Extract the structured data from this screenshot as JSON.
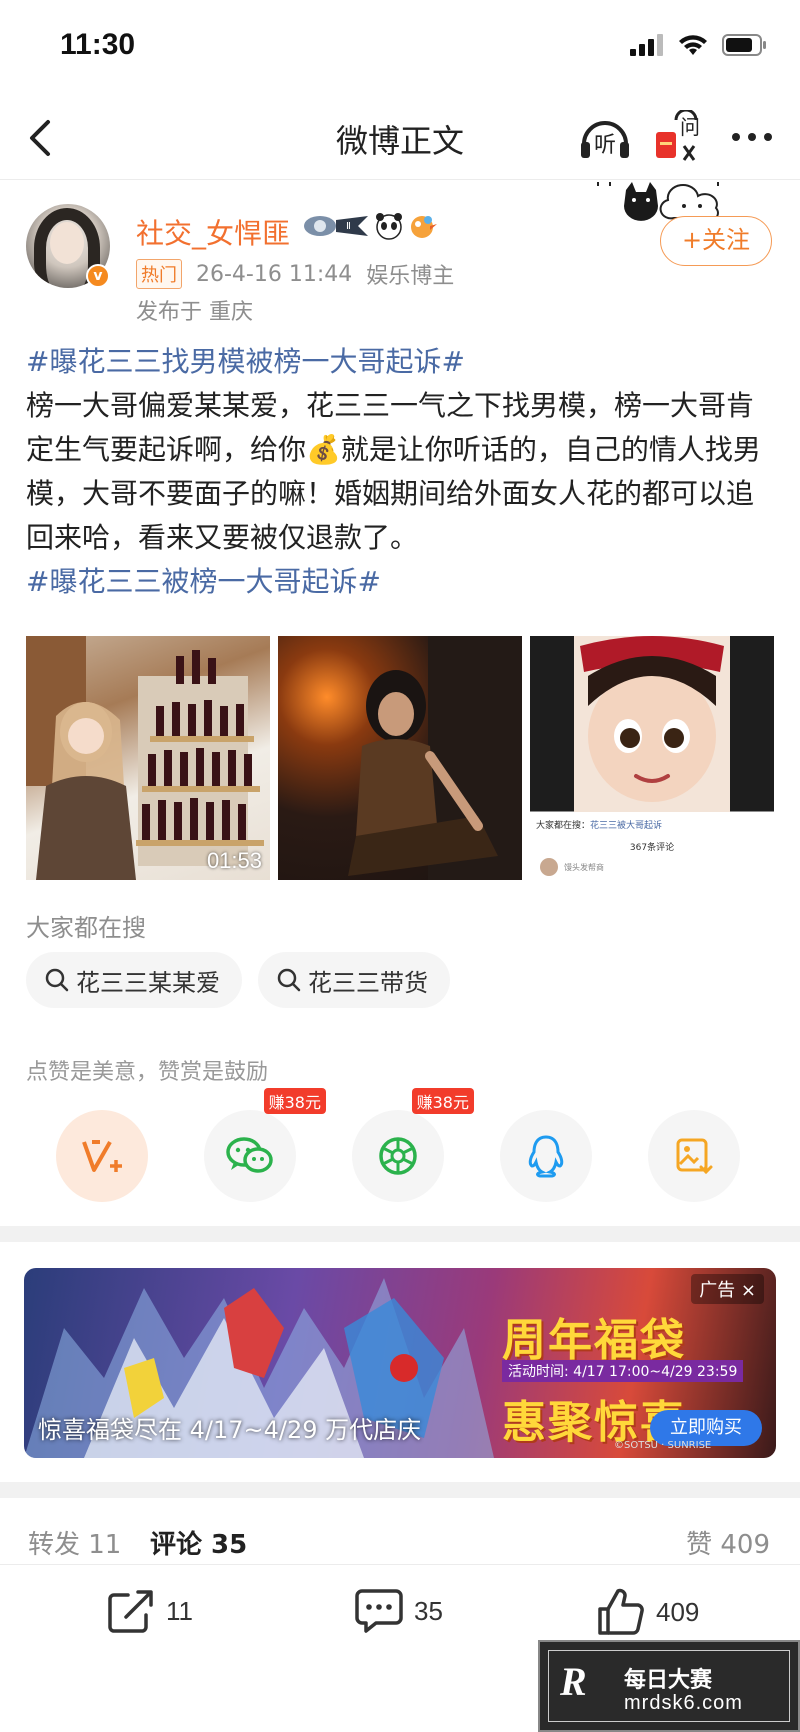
{
  "status_bar": {
    "time": "11:30"
  },
  "nav": {
    "title": "微博正文",
    "listen_label": "听",
    "ask_label": "问"
  },
  "author": {
    "name": "社交_女悍匪",
    "hot_tag": "热门",
    "timestamp": "26-4-16 11:44",
    "title": "娱乐博主",
    "location": "发布于 重庆",
    "follow_label": "+关注"
  },
  "post": {
    "hashtag1": "#曝花三三找男模被榜一大哥起诉#",
    "text_part1": "榜一大哥偏爱某某爱，花三三一气之下找男模，榜一大哥肯定生气要起诉啊，给你",
    "money_emoji": "💰",
    "text_part2": "就是让你听话的，自己的情人找男模，大哥不要面子的嘛！婚姻期间给外面女人花的都可以追回来哈，看来又要被仅退款了。",
    "hashtag2": "#曝花三三被榜一大哥起诉#"
  },
  "media": {
    "video_duration": "01:53",
    "thumb3_search_label": "大家都在搜：",
    "thumb3_search_term": "花三三被大哥起诉",
    "thumb3_comments": "367条评论",
    "thumb3_user": "馒头发帮商"
  },
  "search": {
    "title": "大家都在搜",
    "chips": [
      "花三三某某爱",
      "花三三带货"
    ]
  },
  "praise": {
    "title": "点赞是美意，赞赏是鼓励",
    "earn_badge_wechat": "赚38元",
    "earn_badge_moments": "赚38元"
  },
  "ad": {
    "headline1": "周年福袋",
    "date": "活动时间: 4/17 17:00~4/29 23:59",
    "headline2": "惠聚惊喜",
    "tag": "广告 ×",
    "caption": "惊喜福袋尽在 4/17~4/29 万代店庆",
    "buy_label": "立即购买",
    "copyright": "©SOTSU · SUNRISE"
  },
  "stats": {
    "repost": "转发 11",
    "comment": "评论 35",
    "like": "赞 409"
  },
  "actions": {
    "repost_count": "11",
    "comment_count": "35",
    "like_count": "409"
  },
  "watermark": {
    "logo": "R",
    "line1": "每日大赛",
    "line2": "mrdsk6.com"
  },
  "colors": {
    "brand_orange": "#f07c2a",
    "hashtag_blue": "#4a6aa4",
    "earn_red": "#f23c2b"
  }
}
